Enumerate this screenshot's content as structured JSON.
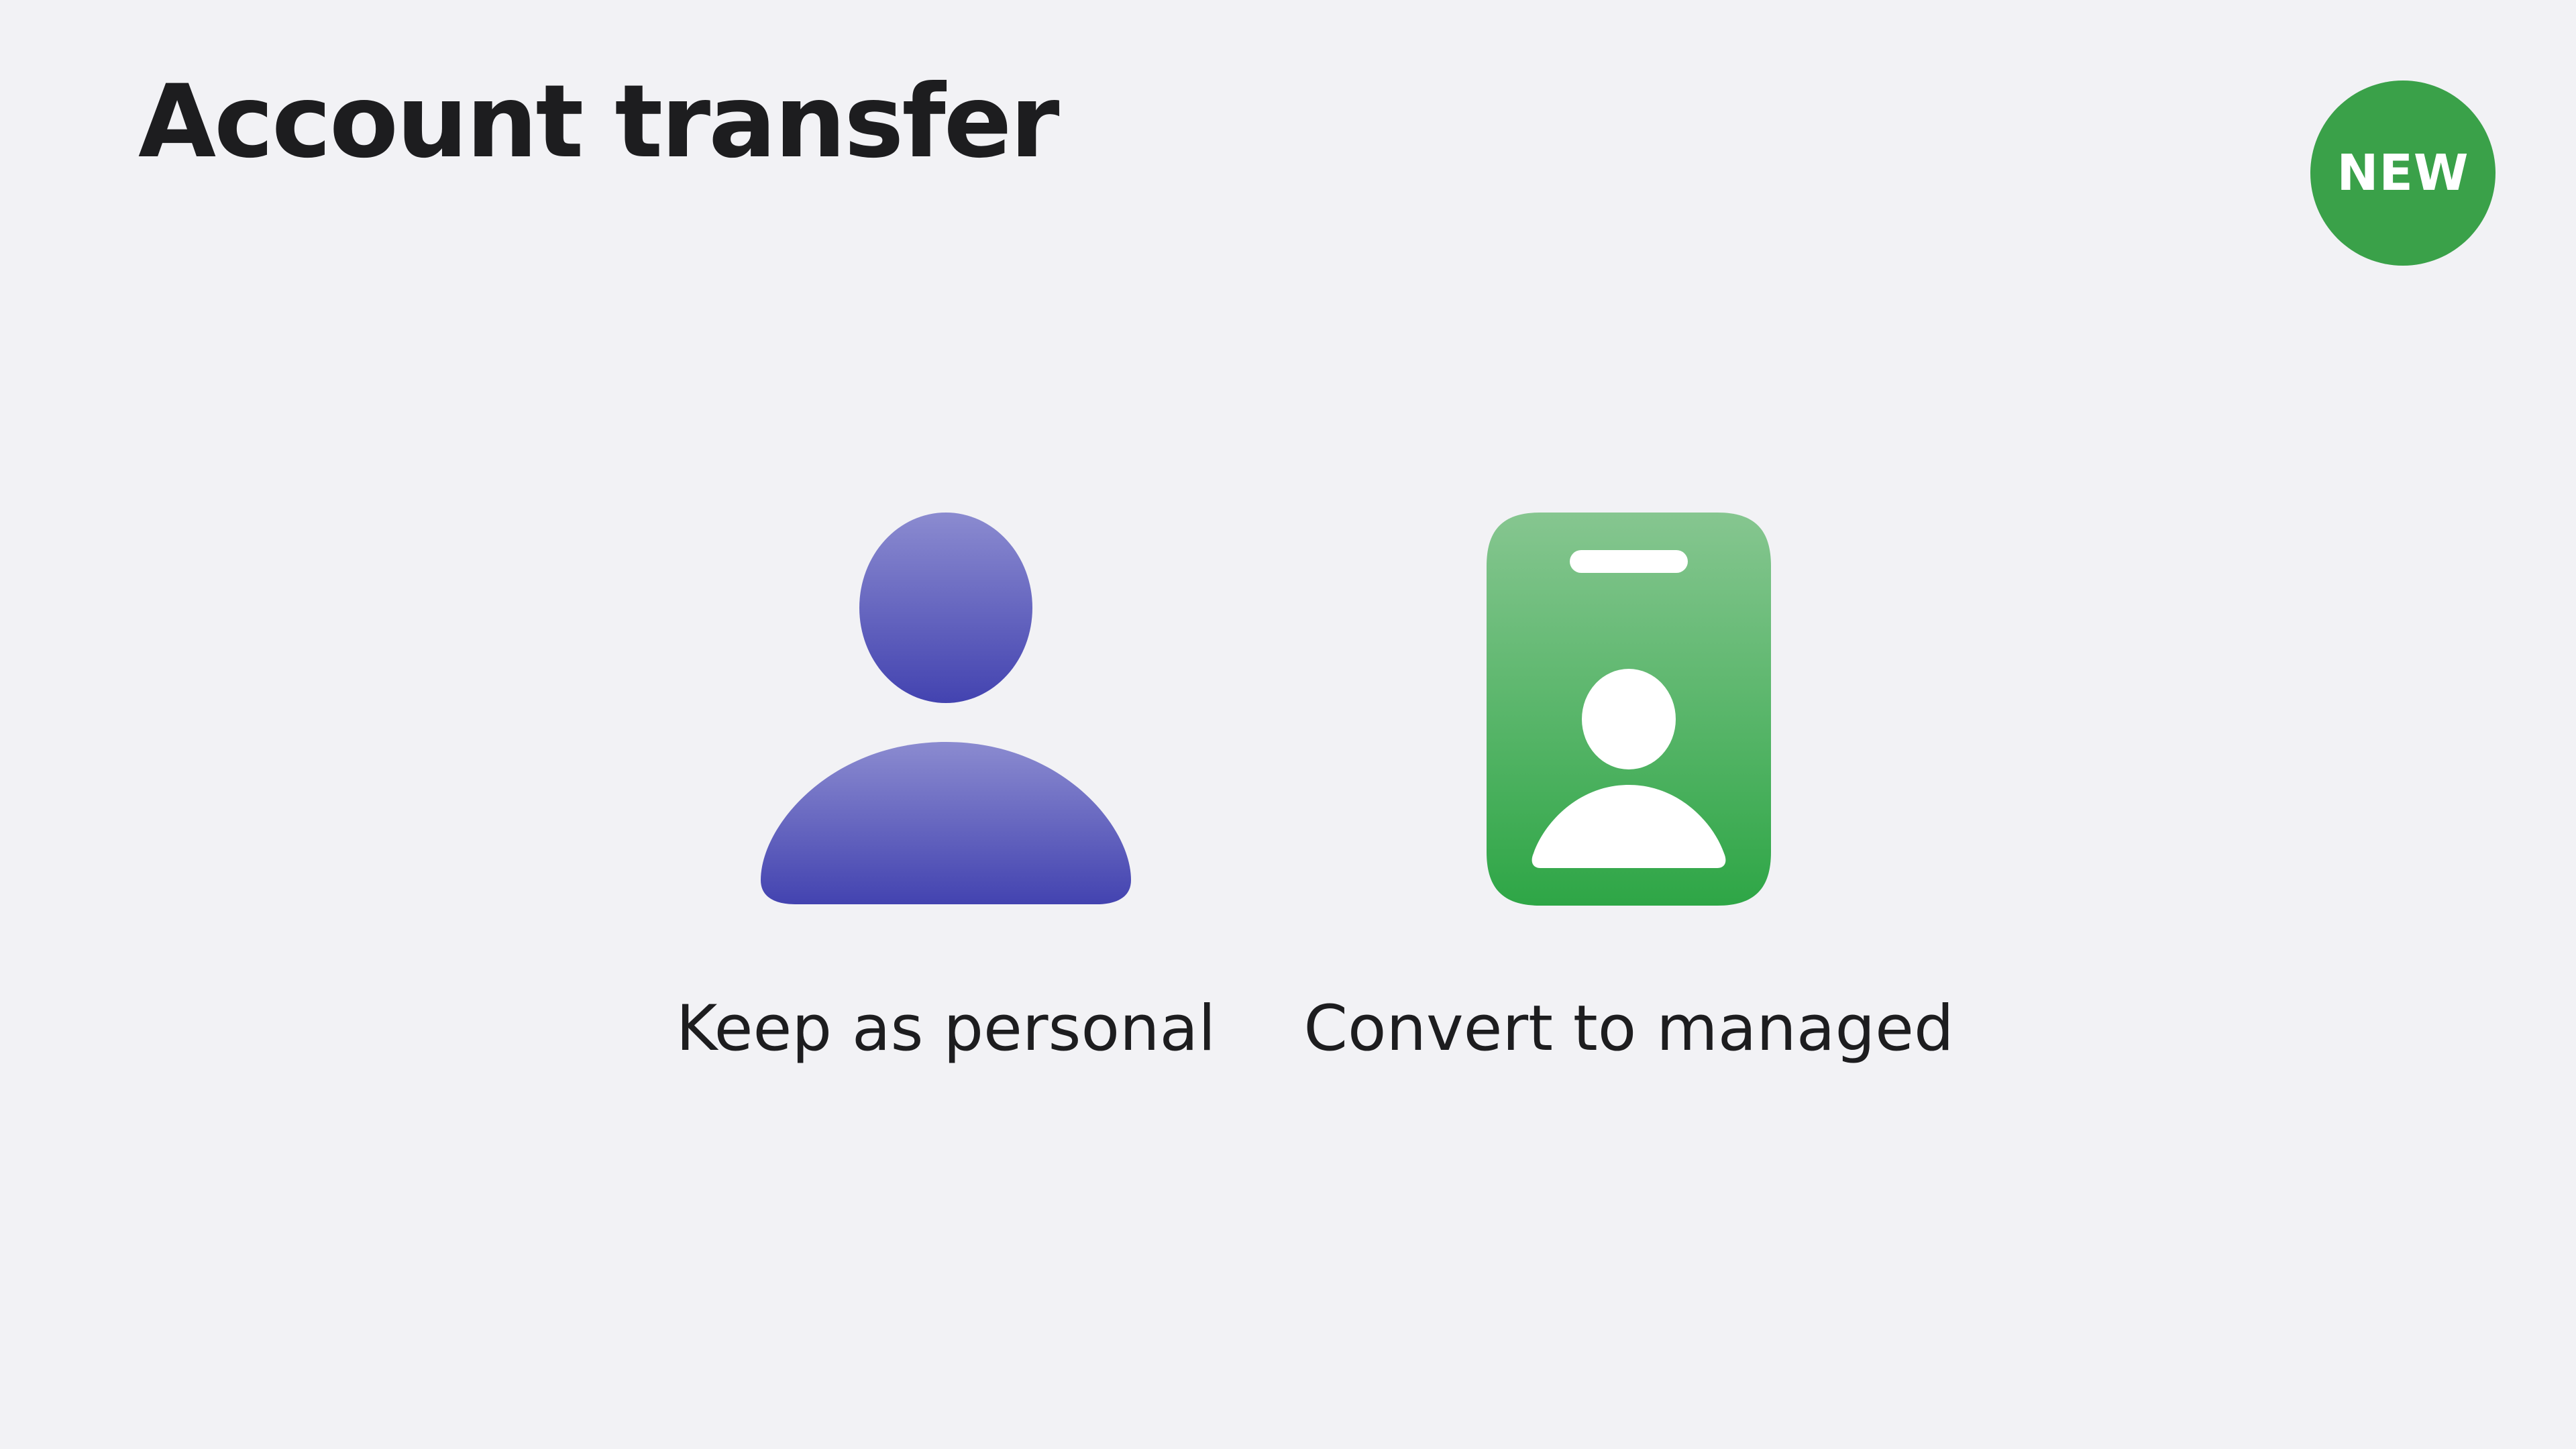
{
  "slide": {
    "title": "Account transfer",
    "badge": "NEW"
  },
  "options": [
    {
      "label": "Keep as personal",
      "icon": "person-icon"
    },
    {
      "label": "Convert to managed",
      "icon": "id-badge-icon"
    }
  ],
  "colors": {
    "background": "#f2f2f5",
    "text": "#1d1d1f",
    "badge": "#3aa149",
    "personal_gradient": [
      "#8b8bd0",
      "#4343b0"
    ],
    "managed_gradient": [
      "#86c690",
      "#2ea646"
    ]
  }
}
